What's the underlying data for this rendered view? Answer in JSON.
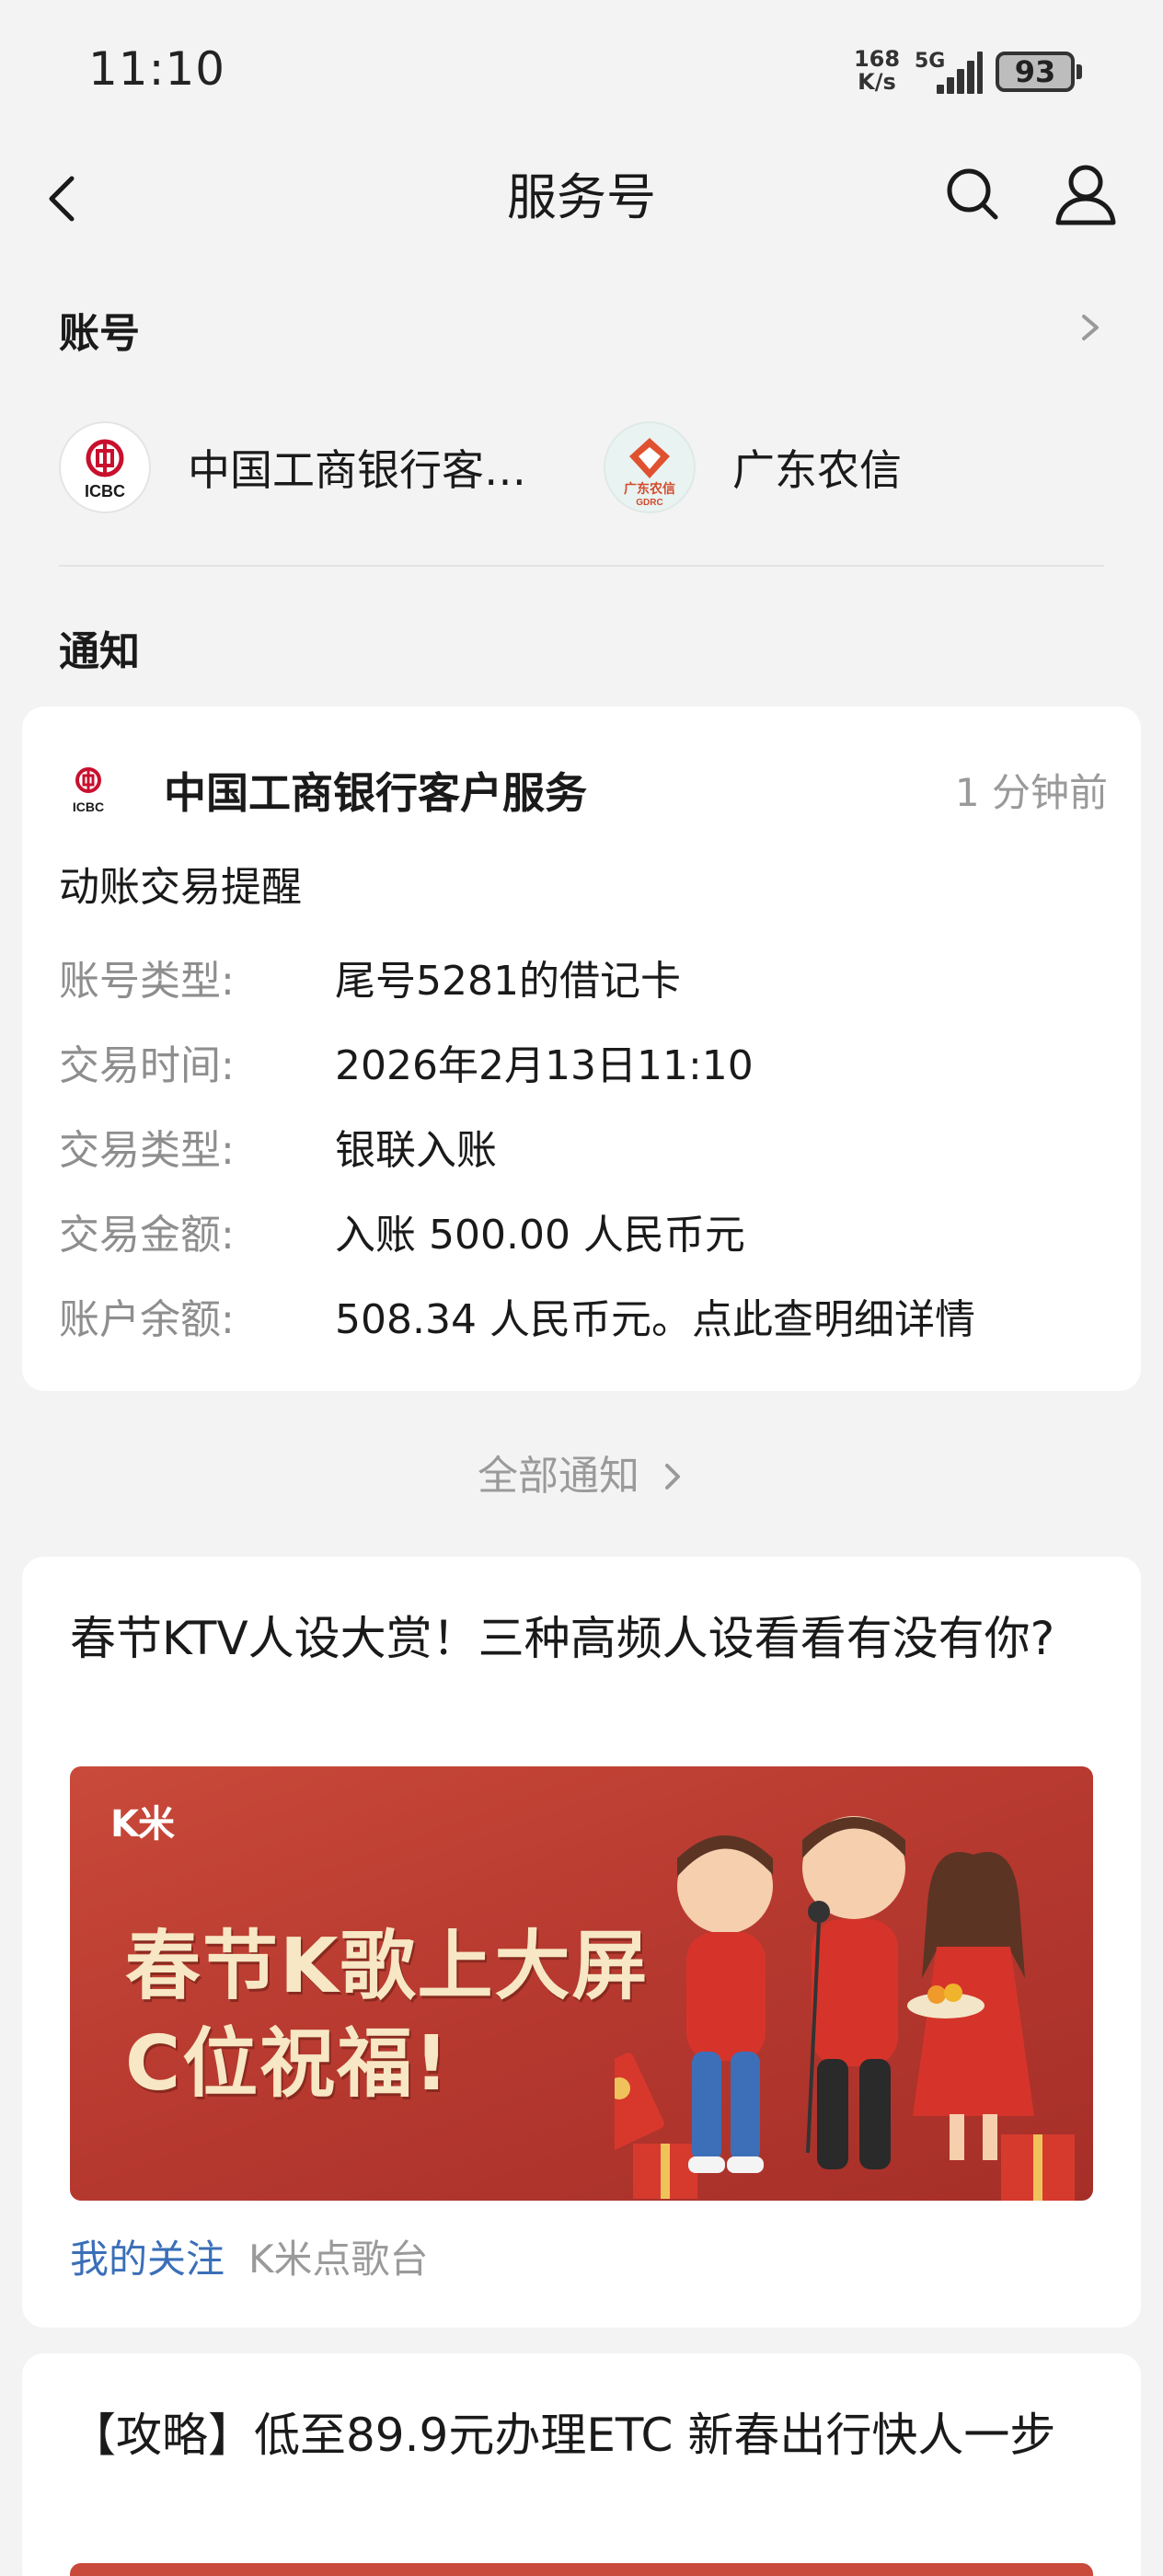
{
  "status_bar": {
    "time": "11:10",
    "net_speed_value": "168",
    "net_speed_unit": "K/s",
    "network": "5G",
    "battery": "93"
  },
  "header": {
    "title": "服务号",
    "back_icon": "back-arrow-icon",
    "search_icon": "search-icon",
    "profile_icon": "user-icon"
  },
  "accounts_section": {
    "title": "账号",
    "items": [
      {
        "name": "中国工商银行客…",
        "logo_text": "ICBC"
      },
      {
        "name": "广东农信",
        "logo_text": "广东农信",
        "logo_subtext": "GDRC"
      }
    ]
  },
  "notifications_section": {
    "title": "通知",
    "card": {
      "sender": "中国工商银行客户服务",
      "sender_logo_text": "ICBC",
      "time": "1 分钟前",
      "subject": "动账交易提醒",
      "fields": [
        {
          "label": "账号类型:",
          "value": "尾号5281的借记卡"
        },
        {
          "label": "交易时间:",
          "value": "2026年2月13日11:10"
        },
        {
          "label": "交易类型:",
          "value": "银联入账"
        },
        {
          "label": "交易金额:",
          "value": "入账 500.00 人民币元"
        },
        {
          "label": "账户余额:",
          "value": "508.34 人民币元。点此查明细详情"
        }
      ]
    },
    "all_link": "全部通知"
  },
  "articles": [
    {
      "title": "春节KTV人设大赏！三种高频人设看看有没有你?",
      "banner": {
        "brand": "K米",
        "line1": "春节K歌上大屏",
        "line2": "C位祝福!"
      },
      "follow_label": "我的关注",
      "source": "K米点歌台"
    },
    {
      "title": "【攻略】低至89.9元办理ETC 新春出行快人一步"
    }
  ],
  "colors": {
    "background": "#f3f3f3",
    "card": "#ffffff",
    "link_blue": "#3a6fb8",
    "muted": "#9a9a9a",
    "icbc_red": "#c8102e",
    "banner_red": "#b83a30"
  }
}
